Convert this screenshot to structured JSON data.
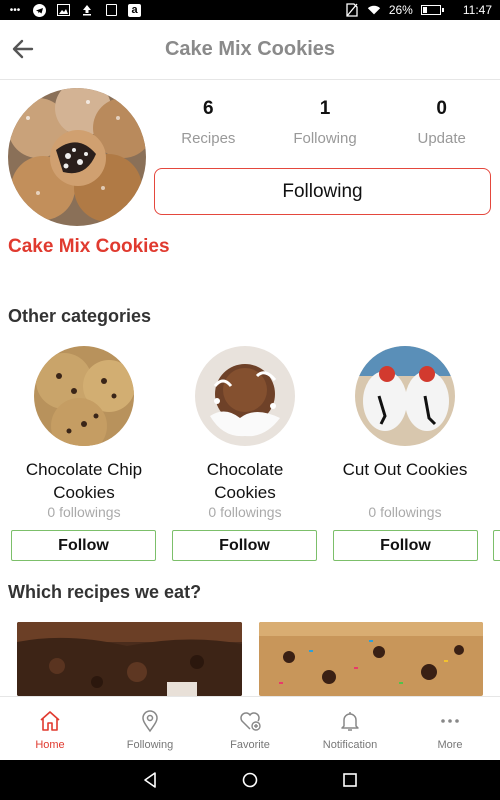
{
  "status_bar": {
    "battery_percent": "26%",
    "time": "11:47",
    "battery_level": 0.26
  },
  "header": {
    "title": "Cake Mix Cookies"
  },
  "profile": {
    "name": "Cake Mix Cookies",
    "following_button_label": "Following",
    "stats": [
      {
        "value": "6",
        "label": "Recipes"
      },
      {
        "value": "1",
        "label": "Following"
      },
      {
        "value": "0",
        "label": "Update"
      }
    ]
  },
  "other_categories": {
    "title": "Other categories",
    "items": [
      {
        "name_line1": "Chocolate Chip",
        "name_line2": "Cookies",
        "followings": "0 followings",
        "button": "Follow"
      },
      {
        "name_line1": "Chocolate",
        "name_line2": "Cookies",
        "followings": "0 followings",
        "button": "Follow"
      },
      {
        "name_line1": "Cut Out Cookies",
        "name_line2": "",
        "followings": "0 followings",
        "button": "Follow"
      }
    ]
  },
  "recipes_section": {
    "title": "Which recipes we eat?"
  },
  "bottom_nav": {
    "items": [
      {
        "label": "Home",
        "icon": "home-icon",
        "active": true
      },
      {
        "label": "Following",
        "icon": "location-pin-icon",
        "active": false
      },
      {
        "label": "Favorite",
        "icon": "heart-plus-icon",
        "active": false
      },
      {
        "label": "Notification",
        "icon": "bell-icon",
        "active": false
      },
      {
        "label": "More",
        "icon": "more-dots-icon",
        "active": false
      }
    ]
  },
  "colors": {
    "accent": "#e03a2f",
    "follow_border": "#7cbf6a",
    "title_gray": "#8a8a8a"
  }
}
